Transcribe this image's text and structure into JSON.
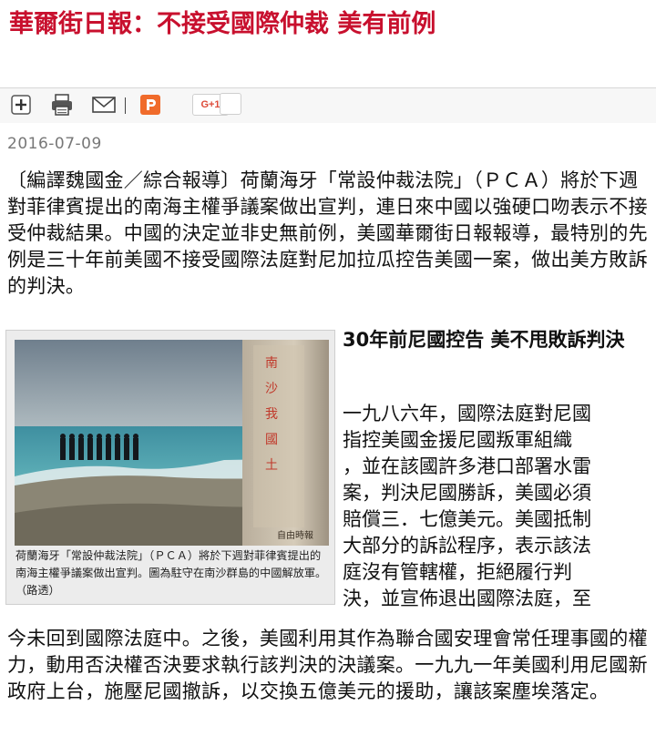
{
  "article": {
    "headline": "華爾街日報：不接受國際仲裁 美有前例",
    "date": "2016-07-09",
    "lead": "〔編譯魏國金／綜合報導〕荷蘭海牙「常設仲裁法院」（ＰＣＡ）將於下週對菲律賓提出的南海主權爭議案做出宣判，連日來中國以強硬口吻表示不接受仲裁結果。中國的決定並非史無前例，美國華爾街日報報導，最特別的先例是三十年前美國不接受國際法庭對尼加拉瓜控告美國一案，做出美方敗訴的判決。",
    "figure": {
      "caption": "荷蘭海牙「常設仲裁法院」（ＰＣＡ）將於下週對菲律賓提出的南海主權爭議案做出宣判。圖為駐守在南沙群島的中國解放軍。（路透）",
      "stone_inscription": "南沙我國土",
      "watermark": "自由時報"
    },
    "subhead": "30年前尼國控告 美不甩敗訴判決",
    "body_lines": [
      "一九八六年，國際法庭對尼國",
      "指控美國金援尼國叛軍組織",
      "，並在該國許多港口部署水雷",
      "案，判決尼國勝訴，美國必須",
      "賠償三．七億美元。美國抵制",
      "大部分的訴訟程序，表示該法",
      "庭沒有管轄權，拒絕履行判",
      "決，並宣佈退出國際法庭，至"
    ],
    "body_continued": "今未回到國際法庭中。之後，美國利用其作為聯合國安理會常任理事國的權力，動用否決權否決要求執行該判決的決議案。一九九一年美國利用尼國新政府上台，施壓尼國撤訴，以交換五億美元的援助，讓該案塵埃落定。"
  },
  "toolbar": {
    "items": [
      {
        "name": "plus-icon"
      },
      {
        "name": "print-icon"
      },
      {
        "name": "mail-icon"
      },
      {
        "name": "plurk-icon"
      },
      {
        "name": "google-plus-button"
      }
    ],
    "gplus_label": "G+1"
  },
  "colors": {
    "headline": "#c8102e",
    "plurk": "#f06b2b",
    "gplus": "#dd4b39"
  }
}
